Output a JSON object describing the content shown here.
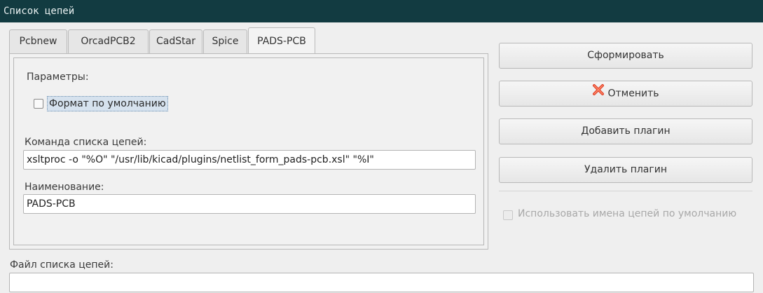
{
  "window": {
    "title": "Список цепей"
  },
  "tabs": [
    {
      "label": "Pcbnew"
    },
    {
      "label": "OrcadPCB2"
    },
    {
      "label": "CadStar"
    },
    {
      "label": "Spice"
    },
    {
      "label": "PADS-PCB",
      "active": true
    }
  ],
  "panel": {
    "params_label": "Параметры:",
    "default_format": {
      "label": "Формат по умолчанию",
      "checked": false
    },
    "command_label": "Команда списка цепей:",
    "command_value": "xsltproc -o \"%O\" \"/usr/lib/kicad/plugins/netlist_form_pads-pcb.xsl\" \"%I\"",
    "name_label": "Наименование:",
    "name_value": "PADS-PCB"
  },
  "buttons": {
    "generate": "Сформировать",
    "cancel": "Отменить",
    "cancel_icon": "red-x-icon",
    "add_plugin": "Добавить плагин",
    "remove_plugin": "Удалить плагин"
  },
  "use_default_netnames": {
    "label": "Использовать имена цепей по умолчанию",
    "checked": false,
    "enabled": false
  },
  "netlist_file": {
    "label": "Файл списка цепей:",
    "value": ""
  },
  "colors": {
    "titlebar": "#123b41",
    "cancel_icon": "#e0442c",
    "focus": "#d6e2ee"
  }
}
